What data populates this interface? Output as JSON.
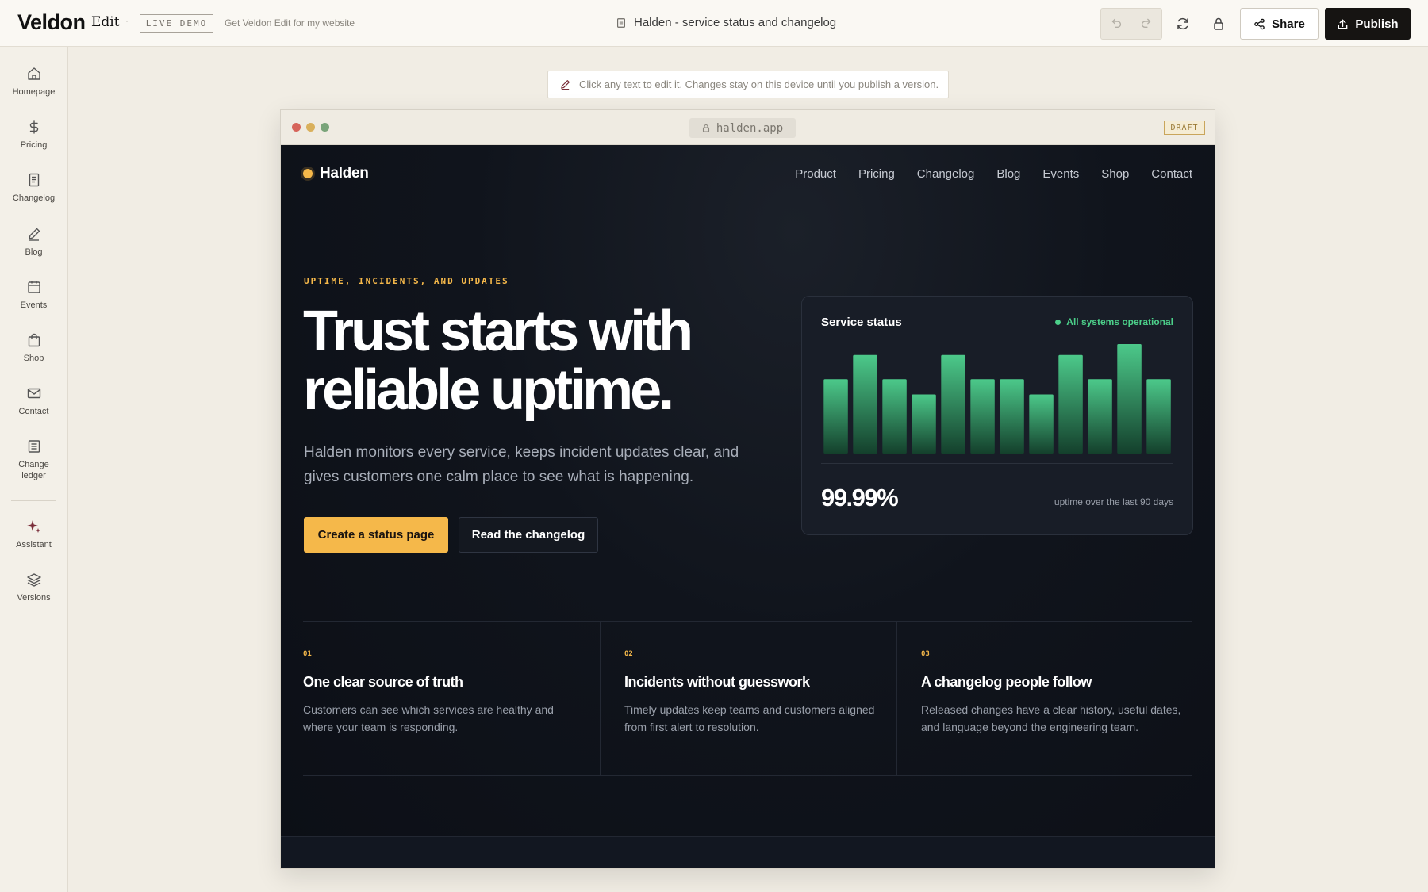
{
  "app": {
    "brand": "Veldon",
    "mode": "Edit",
    "separator": "·",
    "badge": "LIVE DEMO",
    "promo_link": "Get Veldon Edit for my website",
    "document_title": "Halden - service status and changelog",
    "share_label": "Share",
    "publish_label": "Publish"
  },
  "sidebar": {
    "items": [
      {
        "label": "Homepage",
        "icon": "home-icon"
      },
      {
        "label": "Pricing",
        "icon": "dollar-icon"
      },
      {
        "label": "Changelog",
        "icon": "document-icon"
      },
      {
        "label": "Blog",
        "icon": "pencil-icon"
      },
      {
        "label": "Events",
        "icon": "calendar-icon"
      },
      {
        "label": "Shop",
        "icon": "shopping-bag-icon"
      },
      {
        "label": "Contact",
        "icon": "mail-icon"
      },
      {
        "label": "Change ledger",
        "icon": "ledger-icon"
      }
    ],
    "tools": [
      {
        "label": "Assistant",
        "icon": "sparkle-icon"
      },
      {
        "label": "Versions",
        "icon": "layers-icon"
      }
    ]
  },
  "editor": {
    "hint": "Click any text to edit it. Changes stay on this device until you publish a version."
  },
  "browser": {
    "url": "halden.app",
    "status_badge": "DRAFT"
  },
  "site": {
    "logo": "Halden",
    "nav": [
      "Product",
      "Pricing",
      "Changelog",
      "Blog",
      "Events",
      "Shop",
      "Contact"
    ],
    "hero": {
      "eyebrow": "UPTIME, INCIDENTS, AND UPDATES",
      "title": "Trust starts with reliable uptime.",
      "subtitle": "Halden monitors every service, keeps incident updates clear, and gives customers one calm place to see what is happening.",
      "primary_cta": "Create a status page",
      "secondary_cta": "Read the changelog"
    },
    "status_card": {
      "title": "Service status",
      "status": "All systems operational",
      "uptime": "99.99%",
      "caption": "uptime over the last 90 days"
    },
    "features": [
      {
        "num": "01",
        "title": "One clear source of truth",
        "desc": "Customers can see which services are healthy and where your team is responding."
      },
      {
        "num": "02",
        "title": "Incidents without guesswork",
        "desc": "Timely updates keep teams and customers aligned from first alert to resolution."
      },
      {
        "num": "03",
        "title": "A changelog people follow",
        "desc": "Released changes have a clear history, useful dates, and language beyond the engineering team."
      }
    ]
  },
  "colors": {
    "accent": "#f5b84a",
    "bar_top": "#4cc98a",
    "bar_bottom": "#14402c",
    "status_green": "#4cd08a"
  },
  "chart_data": {
    "type": "bar",
    "values": [
      0.68,
      0.9,
      0.68,
      0.54,
      0.9,
      0.68,
      0.68,
      0.54,
      0.9,
      0.68,
      1.0,
      0.68
    ],
    "ylim": [
      0,
      1
    ]
  }
}
